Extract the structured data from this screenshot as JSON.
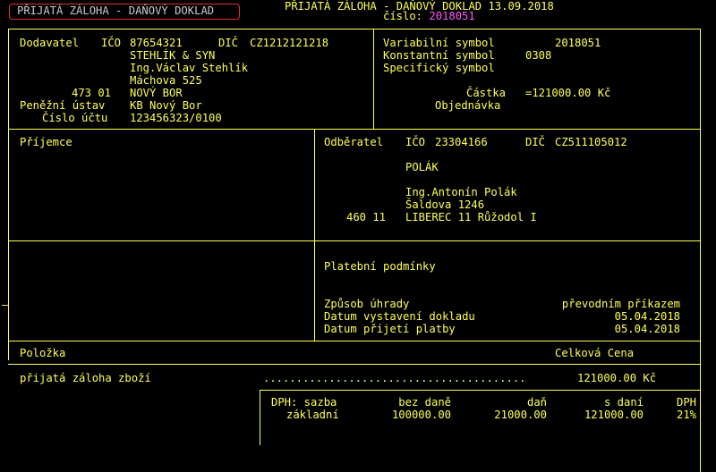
{
  "title": "PŘIJATÁ ZÁLOHA - DAŇOVÝ DOKLAD 13.09.2018",
  "doc_type_label": "PŘIJATÁ ZÁLOHA - DAŇOVÝ DOKLAD",
  "cislo_label": "číslo:",
  "cislo_value": "2018051",
  "supplier": {
    "label": "Dodavatel",
    "ico_label": "IČO",
    "ico": "87654321",
    "dic_label": "DIČ",
    "dic": "CZ1212121218",
    "name": "STEHLÍK & SYN",
    "person": "Ing.Václav Stehlík",
    "street": "Máchova 525",
    "zip": "473 01",
    "city": "NOVÝ BOR",
    "bank_label": "Peněžní ústav",
    "bank": "KB Nový Bor",
    "account_label": "Číslo účtu",
    "account": "123456323/0100"
  },
  "symbols": {
    "variabilni_label": "Variabilní symbol",
    "variabilni": "2018051",
    "konstantni_label": "Konstantní symbol",
    "konstantni": "0308",
    "specificky_label": "Specifický symbol",
    "castka_label": "Částka",
    "castka": "=121000.00 Kč",
    "objednavka_label": "Objednávka"
  },
  "prijemce_label": "Příjemce",
  "customer": {
    "label": "Odběratel",
    "ico_label": "IČO",
    "ico": "23304166",
    "dic_label": "DIČ",
    "dic": "CZ511105012",
    "name": "POLÁK",
    "person": "Ing.Antonín Polák",
    "street": "Šaldova 1246",
    "zip": "460 11",
    "city": "LIBEREC 11 Růžodol I"
  },
  "payment": {
    "title": "Platební podmínky",
    "method_label": "Způsob úhrady",
    "method": "převodním příkazem",
    "issued_label": "Datum vystavení dokladu",
    "issued": "05.04.2018",
    "received_label": "Datum přijetí platby",
    "received": "05.04.2018"
  },
  "items": {
    "col_item": "Položka",
    "col_total": "Celková Cena",
    "row_name": "přijatá záloha zboží",
    "row_dots": "........................................",
    "row_total": "121000.00 Kč"
  },
  "vat": {
    "headers": [
      "DPH: sazba",
      "bez daně",
      "daň",
      "s daní",
      "DPH"
    ],
    "row": [
      "základní",
      "100000.00",
      "21000.00",
      "121000.00",
      "21%"
    ]
  },
  "cursor_mark": "—"
}
